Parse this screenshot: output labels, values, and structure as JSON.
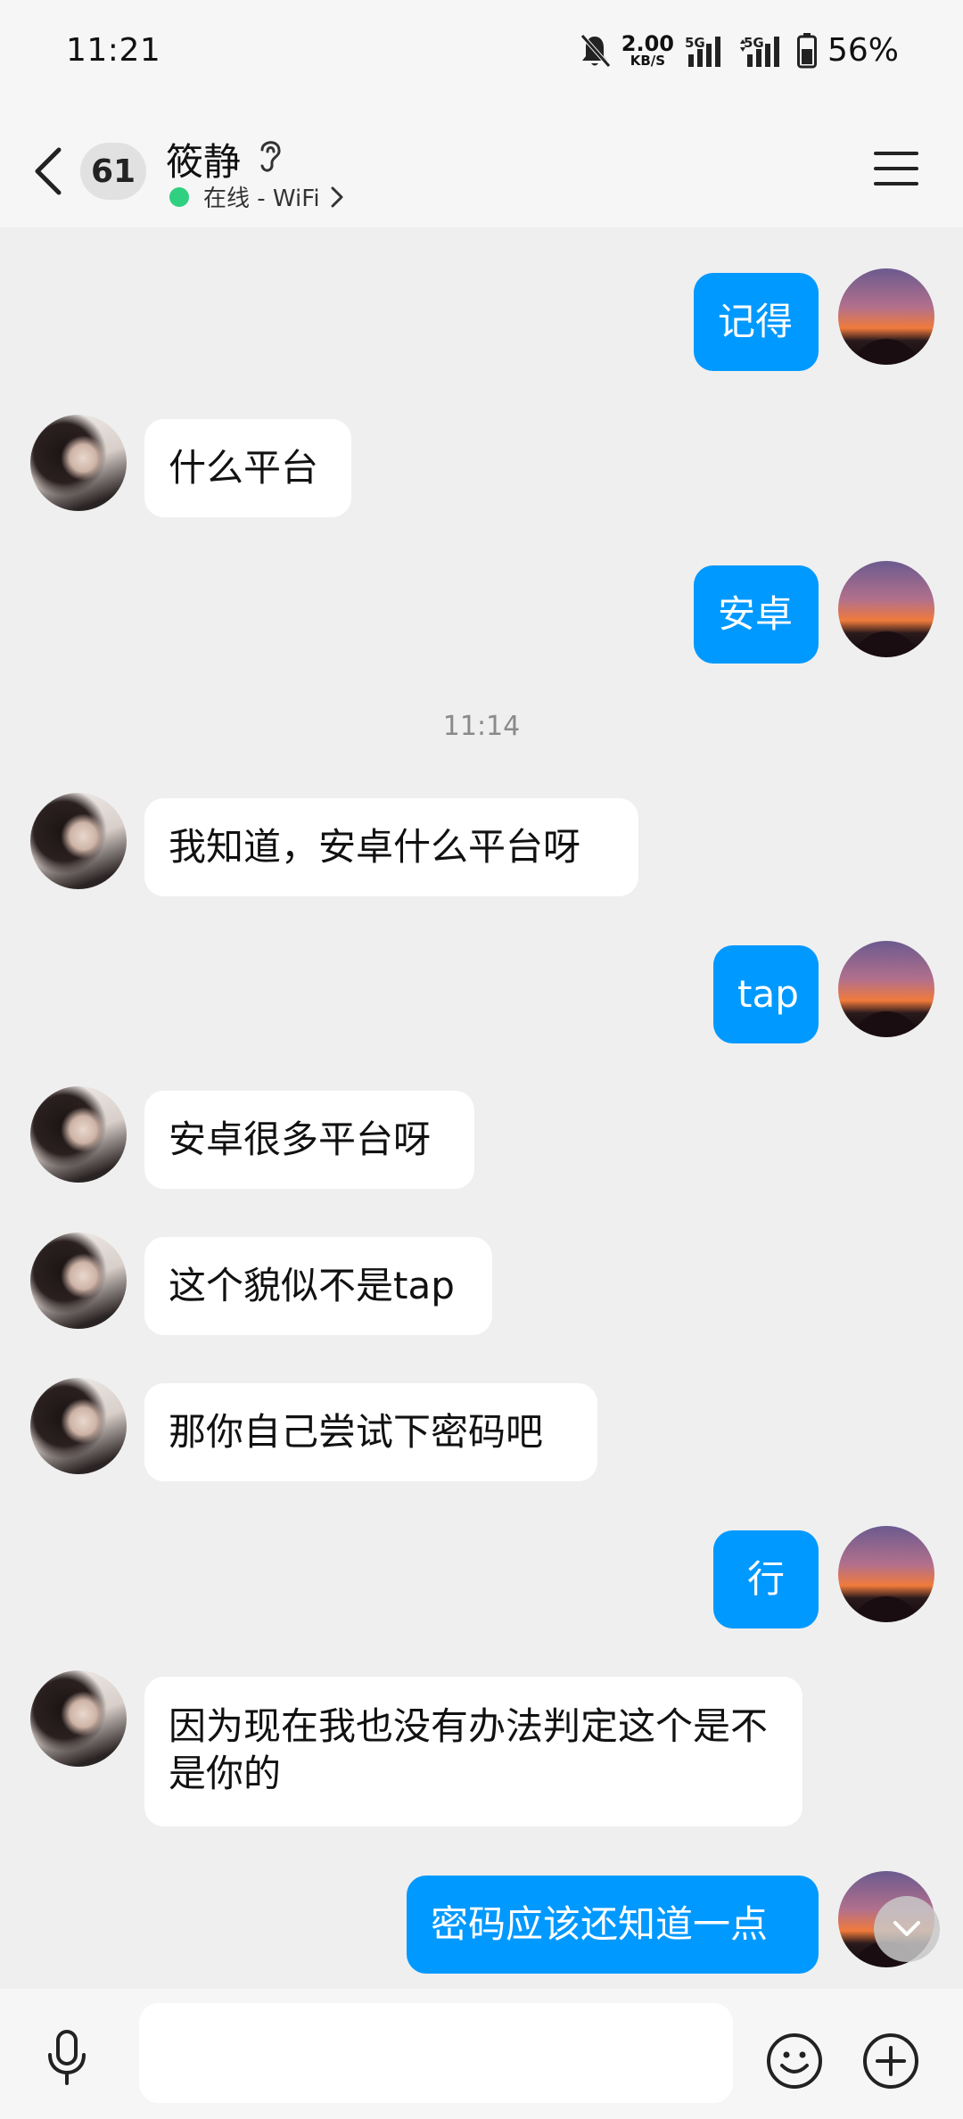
{
  "status_bar": {
    "time": "11:21",
    "net_speed_value": "2.00",
    "net_speed_unit": "KB/S",
    "signal1_label": "5G",
    "signal2_label": "5G",
    "battery_percent": "56%"
  },
  "header": {
    "unread_count": "61",
    "contact_name": "筱静",
    "online_status": "在线 - WiFi"
  },
  "messages": [
    {
      "side": "out",
      "text": "记得"
    },
    {
      "side": "in",
      "text": "什么平台"
    },
    {
      "side": "out",
      "text": "安卓"
    },
    {
      "type": "time",
      "text": "11:14"
    },
    {
      "side": "in",
      "text": "我知道，安卓什么平台呀"
    },
    {
      "side": "out",
      "text": "tap"
    },
    {
      "side": "in",
      "text": "安卓很多平台呀"
    },
    {
      "side": "in",
      "text": "这个貌似不是tap"
    },
    {
      "side": "in",
      "text": "那你自己尝试下密码吧"
    },
    {
      "side": "out",
      "text": "行"
    },
    {
      "side": "in",
      "text": "因为现在我也没有办法判定这个是不是你的"
    },
    {
      "side": "out",
      "text": "密码应该还知道一点"
    }
  ],
  "input": {
    "value": "",
    "placeholder": ""
  },
  "colors": {
    "accent": "#0099ff",
    "background": "#efefef",
    "online": "#2fd07f"
  },
  "icons": [
    "back-icon",
    "ear-icon",
    "chevron-right-icon",
    "menu-icon",
    "microphone-icon",
    "emoji-icon",
    "plus-icon",
    "chevron-down-icon"
  ]
}
